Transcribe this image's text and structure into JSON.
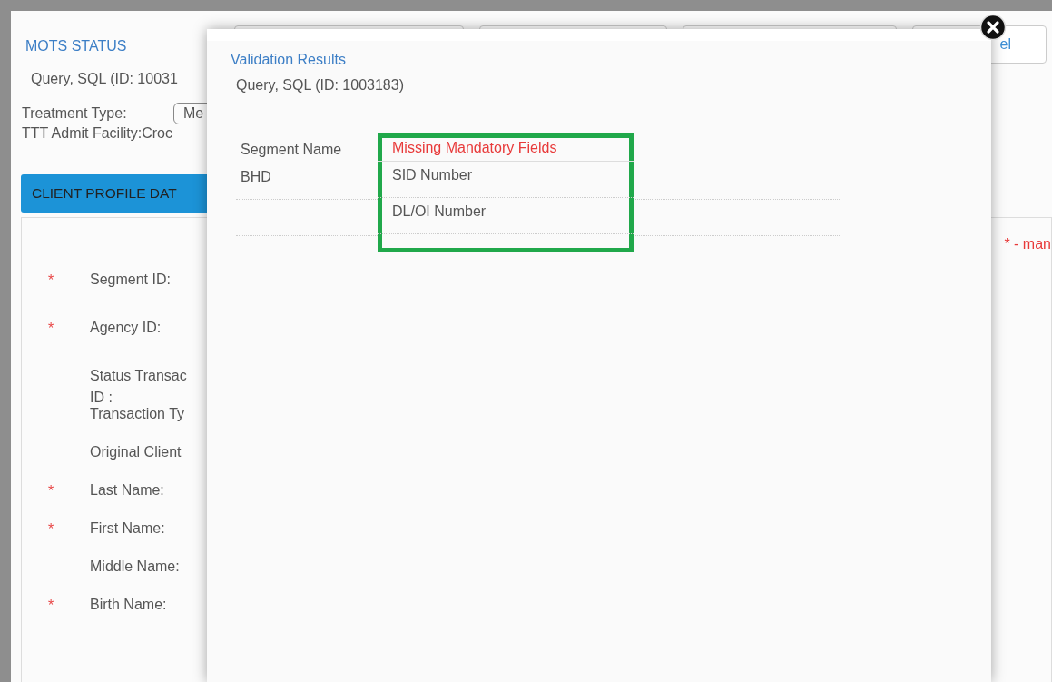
{
  "page": {
    "title": "MOTS STATUS",
    "client": "Query, SQL (ID: 10031",
    "buttons": [
      {
        "label": "el"
      }
    ],
    "treatment": {
      "label": "Treatment Type:",
      "value": "Me"
    },
    "facility": {
      "label": "TTT Admit Facility:",
      "value": "Croc"
    },
    "section_title": "CLIENT PROFILE DAT",
    "legend": "* - man",
    "fields": [
      {
        "label": "Segment ID:",
        "required": true,
        "marker": "*"
      },
      {
        "label": "Agency ID:",
        "required": true,
        "marker": "*"
      },
      {
        "label": "Status Transac\nID :",
        "required": false
      },
      {
        "label": "Transaction Ty",
        "required": false
      },
      {
        "label": "Original Client",
        "required": false
      },
      {
        "label": "Last Name:",
        "required": true,
        "marker": "*"
      },
      {
        "label": "First Name:",
        "required": true,
        "marker": "*"
      },
      {
        "label": "Middle Name:",
        "required": false
      },
      {
        "label": "Birth Name:",
        "required": true,
        "marker": "*"
      }
    ]
  },
  "modal": {
    "title": "Validation Results",
    "subtitle": "Query, SQL (ID: 1003183)",
    "columns": [
      {
        "label": "Segment Name",
        "highlighted": false
      },
      {
        "label": "Missing Mandatory Fields",
        "highlighted": true
      }
    ],
    "rows": [
      {
        "segment_name": "BHD",
        "missing_field": "SID Number"
      },
      {
        "missing_field": "DL/OI Number"
      }
    ]
  }
}
